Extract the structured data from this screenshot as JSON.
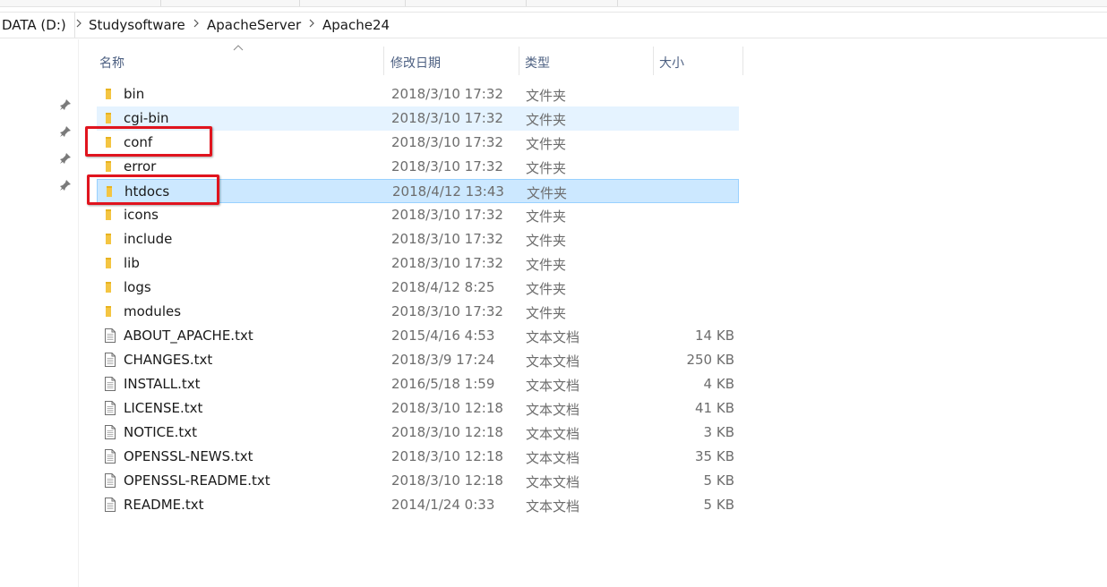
{
  "address": {
    "crumbs": [
      "DATA (D:)",
      "Studysoftware",
      "ApacheServer",
      "Apache24"
    ]
  },
  "columns": {
    "name": "名称",
    "date": "修改日期",
    "type": "类型",
    "size": "大小"
  },
  "files": [
    {
      "name": "bin",
      "date": "2018/3/10 17:32",
      "type": "文件夹",
      "size": "",
      "kind": "folder"
    },
    {
      "name": "cgi-bin",
      "date": "2018/3/10 17:32",
      "type": "文件夹",
      "size": "",
      "kind": "folder"
    },
    {
      "name": "conf",
      "date": "2018/3/10 17:32",
      "type": "文件夹",
      "size": "",
      "kind": "folder"
    },
    {
      "name": "error",
      "date": "2018/3/10 17:32",
      "type": "文件夹",
      "size": "",
      "kind": "folder"
    },
    {
      "name": "htdocs",
      "date": "2018/4/12 13:43",
      "type": "文件夹",
      "size": "",
      "kind": "folder"
    },
    {
      "name": "icons",
      "date": "2018/3/10 17:32",
      "type": "文件夹",
      "size": "",
      "kind": "folder"
    },
    {
      "name": "include",
      "date": "2018/3/10 17:32",
      "type": "文件夹",
      "size": "",
      "kind": "folder"
    },
    {
      "name": "lib",
      "date": "2018/3/10 17:32",
      "type": "文件夹",
      "size": "",
      "kind": "folder"
    },
    {
      "name": "logs",
      "date": "2018/4/12 8:25",
      "type": "文件夹",
      "size": "",
      "kind": "folder"
    },
    {
      "name": "modules",
      "date": "2018/3/10 17:32",
      "type": "文件夹",
      "size": "",
      "kind": "folder"
    },
    {
      "name": "ABOUT_APACHE.txt",
      "date": "2015/4/16 4:53",
      "type": "文本文档",
      "size": "14 KB",
      "kind": "file"
    },
    {
      "name": "CHANGES.txt",
      "date": "2018/3/9 17:24",
      "type": "文本文档",
      "size": "250 KB",
      "kind": "file"
    },
    {
      "name": "INSTALL.txt",
      "date": "2016/5/18 1:59",
      "type": "文本文档",
      "size": "4 KB",
      "kind": "file"
    },
    {
      "name": "LICENSE.txt",
      "date": "2018/3/10 12:18",
      "type": "文本文档",
      "size": "41 KB",
      "kind": "file"
    },
    {
      "name": "NOTICE.txt",
      "date": "2018/3/10 12:18",
      "type": "文本文档",
      "size": "3 KB",
      "kind": "file"
    },
    {
      "name": "OPENSSL-NEWS.txt",
      "date": "2018/3/10 12:18",
      "type": "文本文档",
      "size": "35 KB",
      "kind": "file"
    },
    {
      "name": "OPENSSL-README.txt",
      "date": "2018/3/10 12:18",
      "type": "文本文档",
      "size": "5 KB",
      "kind": "file"
    },
    {
      "name": "README.txt",
      "date": "2014/1/24 0:33",
      "type": "文本文档",
      "size": "5 KB",
      "kind": "file"
    }
  ],
  "row_states": {
    "hovered_index": 1,
    "selected_index": 4,
    "highlighted_indices": [
      2,
      4
    ]
  },
  "colors": {
    "hover": "#e5f3ff",
    "selected": "#cce8ff",
    "annotation": "#e0141e",
    "folder": "#f4c542",
    "header_text": "#4d6082"
  },
  "icons": {
    "folder": "folder-icon",
    "file": "text-file-icon",
    "pin": "pin-icon",
    "crumb_separator": "chevron-right-icon",
    "sort": "sort-up-icon"
  }
}
